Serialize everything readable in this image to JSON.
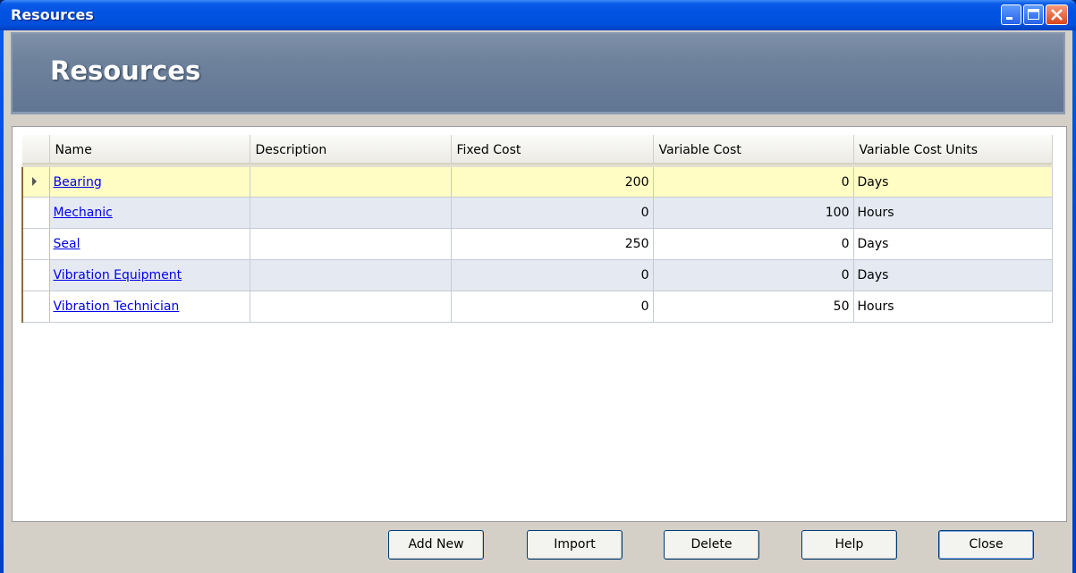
{
  "window": {
    "title": "Resources"
  },
  "header": {
    "title": "Resources"
  },
  "grid": {
    "columns": [
      "Name",
      "Description",
      "Fixed Cost",
      "Variable Cost",
      "Variable Cost Units"
    ],
    "rows": [
      {
        "name": "Bearing",
        "description": "",
        "fixed_cost": "200",
        "variable_cost": "0",
        "units": "Days"
      },
      {
        "name": "Mechanic",
        "description": "",
        "fixed_cost": "0",
        "variable_cost": "100",
        "units": "Hours"
      },
      {
        "name": "Seal",
        "description": "",
        "fixed_cost": "250",
        "variable_cost": "0",
        "units": "Days"
      },
      {
        "name": "Vibration Equipment",
        "description": "",
        "fixed_cost": "0",
        "variable_cost": "0",
        "units": "Days"
      },
      {
        "name": "Vibration Technician",
        "description": "",
        "fixed_cost": "0",
        "variable_cost": "50",
        "units": "Hours"
      }
    ]
  },
  "buttons": {
    "add_new": "Add New",
    "import": "Import",
    "delete": "Delete",
    "help": "Help",
    "close": "Close"
  },
  "colors": {
    "title_bar": "#0054e3",
    "header_band": "#6e829c",
    "selected_row": "#fffdc4",
    "alt_row": "#e5eaf2"
  }
}
